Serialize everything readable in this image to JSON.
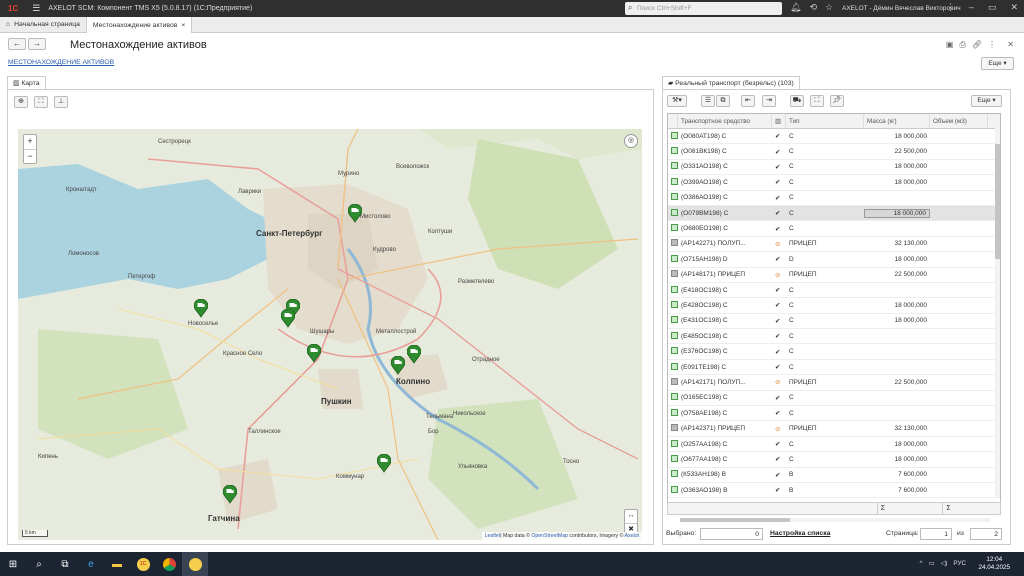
{
  "app": {
    "logo": "1С",
    "title": "AXELOT SCM: Компонент TMS X5 (5.0.8.17)  (1С:Предприятие)",
    "search_placeholder": "Поиск Ctrl+Shift+F",
    "user": "AXELOT - Дёмин Вячеслав Викторович"
  },
  "tabs": [
    {
      "label": "Начальная страница"
    },
    {
      "label": "Местонахождение активов"
    }
  ],
  "page": {
    "title": "Местонахождение активов",
    "link": "МЕСТОНАХОЖДЕНИЕ АКТИВОВ",
    "more": "Еще ▾"
  },
  "map_panel": {
    "tab": "Карта",
    "attribution_leaflet": "Leaflet",
    "attribution_text": "| Map data © ",
    "attribution_osm": "OpenStreetMap",
    "attribution_tail": " contributors, Imagery © ",
    "attribution_axelot": "Axelot",
    "scale": "5 km",
    "places": [
      "Кронштадт",
      "Сестрорецк",
      "Санкт-Петербург",
      "Всеволожск",
      "Мурино",
      "Кудрово",
      "Колпино",
      "Пушкин",
      "Гатчина",
      "Петергоф",
      "Ломоносов",
      "Новоселье",
      "Шушары",
      "Металлострой",
      "Отрадное",
      "Тельмана",
      "Тосно",
      "Коммунар",
      "Кипень",
      "Красное Село",
      "Никольское",
      "Бор",
      "Таллинское",
      "Лаврики",
      "Мистолово",
      "Колтуши",
      "Разметелево",
      "Ульяновка",
      "Пушкин"
    ]
  },
  "grid_panel": {
    "tab": "Реальный транспорт (безрельс) (103)",
    "more": "Еще ▾",
    "headers": {
      "vehicle": "Транспортное средство",
      "type": "Тип",
      "mass": "Масса (кг)",
      "volume": "Объем (м3)"
    },
    "rows": [
      {
        "v": "(О080АТ198) С",
        "m": "✔",
        "t": "С",
        "mass": "18 000,000",
        "g": false
      },
      {
        "v": "(О081ВК198) С",
        "m": "✔",
        "t": "С",
        "mass": "22 500,000",
        "g": false
      },
      {
        "v": "(О331АО198) С",
        "m": "✔",
        "t": "С",
        "mass": "18 000,000",
        "g": false
      },
      {
        "v": "(О399АО198) С",
        "m": "✔",
        "t": "С",
        "mass": "18 000,000",
        "g": false
      },
      {
        "v": "(О386АО198) С",
        "m": "✔",
        "t": "С",
        "mass": "",
        "g": false
      },
      {
        "v": "(О079ВМ198) С",
        "m": "✔",
        "t": "С",
        "mass": "18 000,000",
        "g": false,
        "sel": true
      },
      {
        "v": "(О680ЕО198) С",
        "m": "✔",
        "t": "С",
        "mass": "",
        "g": false
      },
      {
        "v": "(АР142271) ПОЛУП...",
        "m": "⊘",
        "t": "ПРИЦЕП",
        "mass": "32 130,000",
        "g": true
      },
      {
        "v": "(О715АН198) D",
        "m": "✔",
        "t": "D",
        "mass": "18 000,000",
        "g": false
      },
      {
        "v": "(АР148171) ПРИЦЕП",
        "m": "⊘",
        "t": "ПРИЦЕП",
        "mass": "22 500,000",
        "g": true
      },
      {
        "v": "(Е418ОС198) С",
        "m": "✔",
        "t": "С",
        "mass": "",
        "g": false
      },
      {
        "v": "(Е428ОС198) С",
        "m": "✔",
        "t": "С",
        "mass": "18 000,000",
        "g": false
      },
      {
        "v": "(Е431ОС198) С",
        "m": "✔",
        "t": "С",
        "mass": "18 000,000",
        "g": false
      },
      {
        "v": "(Е485ОС198) С",
        "m": "✔",
        "t": "С",
        "mass": "",
        "g": false
      },
      {
        "v": "(Е376ОС198) С",
        "m": "✔",
        "t": "С",
        "mass": "",
        "g": false
      },
      {
        "v": "(Е091ТЕ198) С",
        "m": "✔",
        "t": "С",
        "mass": "",
        "g": false
      },
      {
        "v": "(АР142171) ПОЛУП...",
        "m": "⊘",
        "t": "ПРИЦЕП",
        "mass": "22 500,000",
        "g": true
      },
      {
        "v": "(О165ЕС198) С",
        "m": "✔",
        "t": "С",
        "mass": "",
        "g": false
      },
      {
        "v": "(О758АЕ198) С",
        "m": "✔",
        "t": "С",
        "mass": "",
        "g": false
      },
      {
        "v": "(АР142371) ПРИЦЕП",
        "m": "⊘",
        "t": "ПРИЦЕП",
        "mass": "32 130,000",
        "g": true
      },
      {
        "v": "(О257АА198) С",
        "m": "✔",
        "t": "С",
        "mass": "18 000,000",
        "g": false
      },
      {
        "v": "(О677АА198) С",
        "m": "✔",
        "t": "С",
        "mass": "18 000,000",
        "g": false
      },
      {
        "v": "(К533АН198) В",
        "m": "✔",
        "t": "В",
        "mass": "7 600,000",
        "g": false
      },
      {
        "v": "(О363АО198) В",
        "m": "✔",
        "t": "В",
        "mass": "7 600,000",
        "g": false
      }
    ],
    "footer_sum": "Σ",
    "selected_label": "Выбрано:",
    "selected_value": "0",
    "settings_link": "Настройка списка",
    "page_label": "Страница:",
    "page_value": "1",
    "of_label": "из",
    "of_value": "2"
  },
  "taskbar": {
    "lang": "РУС",
    "time": "12:04",
    "date": "24.04.2025"
  }
}
